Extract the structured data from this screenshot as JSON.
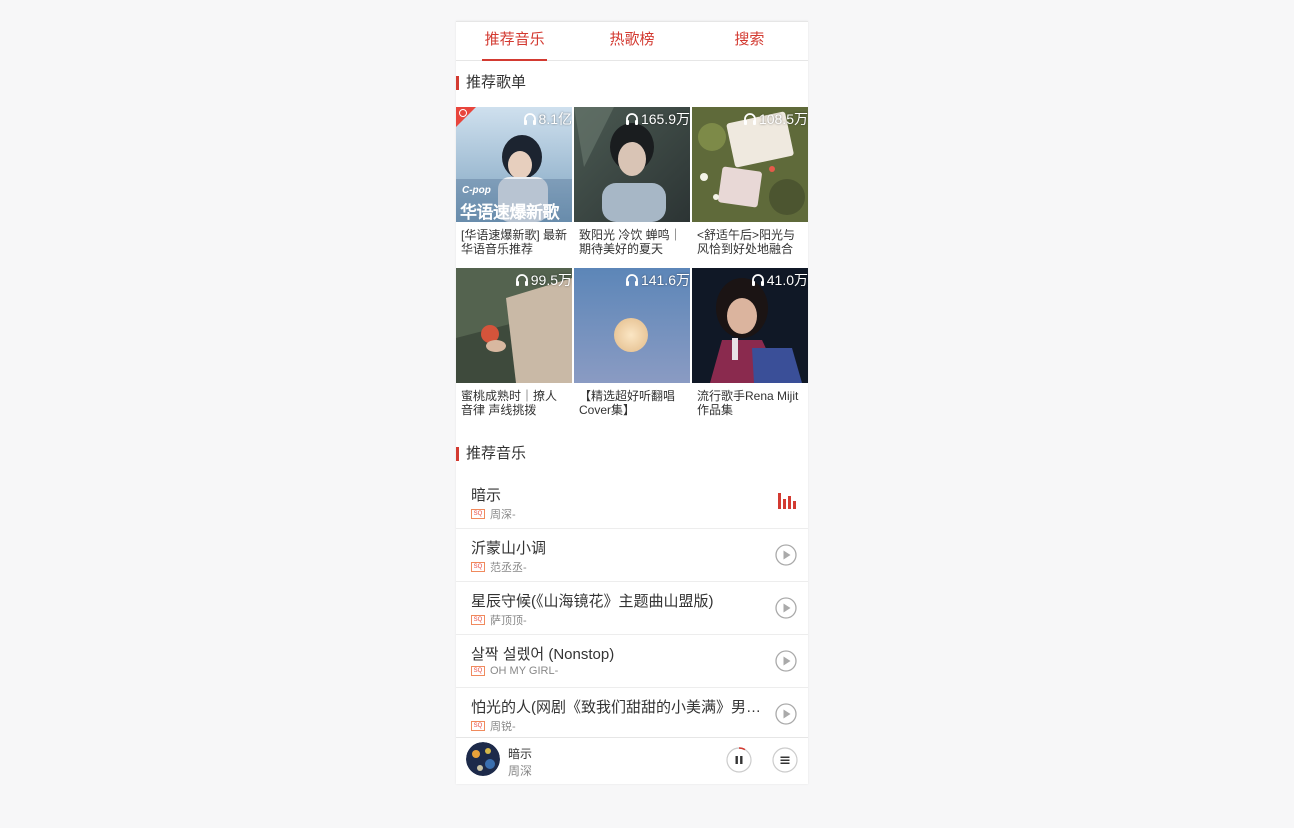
{
  "tabs": [
    {
      "label": "推荐音乐",
      "active": true
    },
    {
      "label": "热歌榜",
      "active": false
    },
    {
      "label": "搜索",
      "active": false
    }
  ],
  "sections": {
    "playlists_title": "推荐歌单",
    "songs_title": "推荐音乐"
  },
  "playlists": [
    {
      "count": "8.1亿",
      "name": "[华语速爆新歌] 最新华语音乐推荐",
      "cover_badge": "C-pop",
      "cover_title": "华语速爆新歌"
    },
    {
      "count": "165.9万",
      "name": "致阳光 冷饮 蝉鸣｜期待美好的夏天"
    },
    {
      "count": "108.5万",
      "name": "<舒适午后>阳光与风恰到好处地融合"
    },
    {
      "count": "99.5万",
      "name": "蜜桃成熟时｜撩人音律 声线挑拨"
    },
    {
      "count": "141.6万",
      "name": "【精选超好听翻唱Cover集】"
    },
    {
      "count": "41.0万",
      "name": "流行歌手Rena Mijit作品集"
    }
  ],
  "songs": [
    {
      "title": "暗示",
      "artist": "周深-",
      "playing": true
    },
    {
      "title": "沂蒙山小调",
      "artist": "范丞丞-",
      "playing": false
    },
    {
      "title": "星辰守候(《山海镜花》主题曲山盟版)",
      "artist": "萨顶顶-",
      "playing": false
    },
    {
      "title": "살짝 설렜어 (Nonstop)",
      "artist": "OH MY GIRL-",
      "playing": false
    },
    {
      "title": "怕光的人(网剧《致我们甜甜的小美满》男主角插曲)",
      "artist": "周锐-",
      "playing": false
    }
  ],
  "sq_label": "SQ",
  "player": {
    "title": "暗示",
    "artist": "周深"
  },
  "colors": {
    "accent": "#d33a31",
    "background": "#f7f7f8"
  }
}
